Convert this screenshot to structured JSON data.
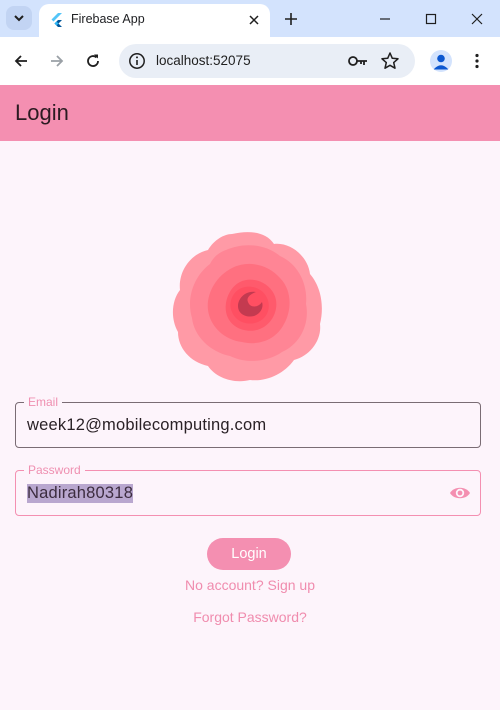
{
  "browser": {
    "tab_title": "Firebase App",
    "url": "localhost:52075",
    "icons": {
      "tab_search": "chevron-down-icon",
      "favicon": "flutter-icon",
      "tab_close": "close-icon",
      "new_tab": "plus-icon",
      "minimize": "minimize-icon",
      "maximize": "maximize-icon",
      "close_window": "close-icon",
      "back": "back-arrow-icon",
      "forward": "forward-arrow-icon",
      "reload": "reload-icon",
      "site_info": "info-icon",
      "passwords": "key-icon",
      "bookmark": "star-icon",
      "profile": "person-icon",
      "menu": "more-vert-icon"
    }
  },
  "app": {
    "appbar_title": "Login",
    "logo": "rose-logo",
    "email": {
      "label": "Email",
      "value": "week12@mobilecomputing.com"
    },
    "password": {
      "label": "Password",
      "value": "Nadirah80318",
      "toggle_icon": "eye-icon"
    },
    "login_button": "Login",
    "signup_link": "No account? Sign up",
    "forgot_link": "Forgot Password?"
  },
  "colors": {
    "primary": "#f48fb1",
    "background": "#fdf4fb",
    "chrome_tabstrip": "#d3e3fd",
    "rose_outer": "#ff8a9a",
    "rose_center": "#c2364e"
  }
}
